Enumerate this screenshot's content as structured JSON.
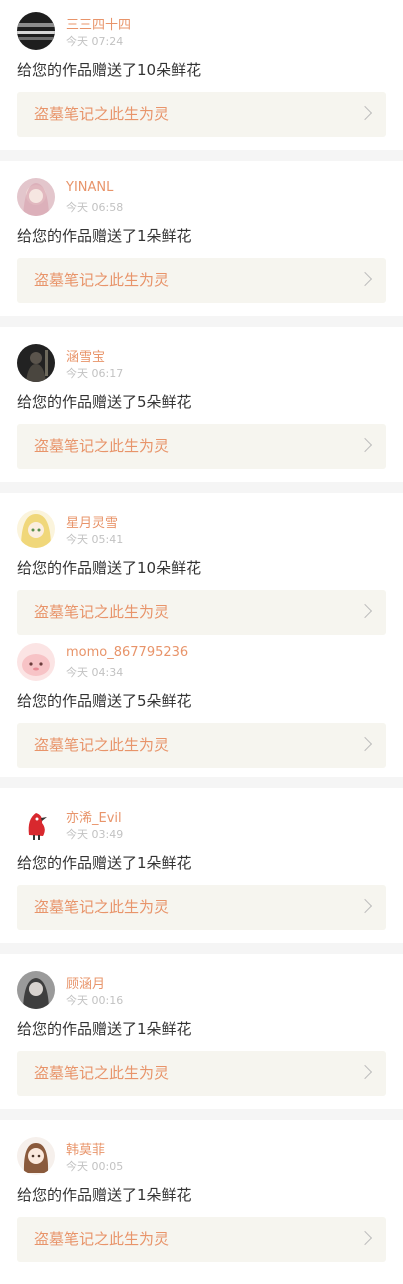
{
  "items": [
    {
      "name": "三三四十四",
      "time": "今天 07:24",
      "message": "给您的作品赠送了10朵鲜花",
      "work_title": "盗墓笔记之此生为灵",
      "avatar_icon": "avatar-dark-stripes",
      "avatar_color": "#2a2a2a"
    },
    {
      "name": "YINANL",
      "time": "今天 06:58",
      "message": "给您的作品赠送了1朵鲜花",
      "work_title": "盗墓笔记之此生为灵",
      "avatar_icon": "avatar-pink-girl",
      "avatar_color": "#e9c9cf"
    },
    {
      "name": "涵雪宝",
      "time": "今天 06:17",
      "message": "给您的作品赠送了5朵鲜花",
      "work_title": "盗墓笔记之此生为灵",
      "avatar_icon": "avatar-dark-figure",
      "avatar_color": "#2b2a28"
    },
    {
      "name": "星月灵雪",
      "time": "今天 05:41",
      "message": "给您的作品赠送了10朵鲜花",
      "work_title": "盗墓笔记之此生为灵",
      "avatar_icon": "avatar-blonde-anime",
      "avatar_color": "#f1e3a6"
    },
    {
      "name": "momo_867795236",
      "time": "今天 04:34",
      "message": "给您的作品赠送了5朵鲜花",
      "work_title": "盗墓笔记之此生为灵",
      "avatar_icon": "avatar-pink-blob",
      "avatar_color": "#f8d6d8"
    },
    {
      "name": "亦浠_Evil",
      "time": "今天 03:49",
      "message": "给您的作品赠送了1朵鲜花",
      "work_title": "盗墓笔记之此生为灵",
      "avatar_icon": "avatar-red-bird",
      "avatar_color": "#ffffff"
    },
    {
      "name": "顾涵月",
      "time": "今天 00:16",
      "message": "给您的作品赠送了1朵鲜花",
      "work_title": "盗墓笔记之此生为灵",
      "avatar_icon": "avatar-gray-portrait",
      "avatar_color": "#8a8a8a"
    },
    {
      "name": "韩莫菲",
      "time": "今天 00:05",
      "message": "给您的作品赠送了1朵鲜花",
      "work_title": "盗墓笔记之此生为灵",
      "avatar_icon": "avatar-brown-hair-girl",
      "avatar_color": "#f3ece7"
    }
  ]
}
